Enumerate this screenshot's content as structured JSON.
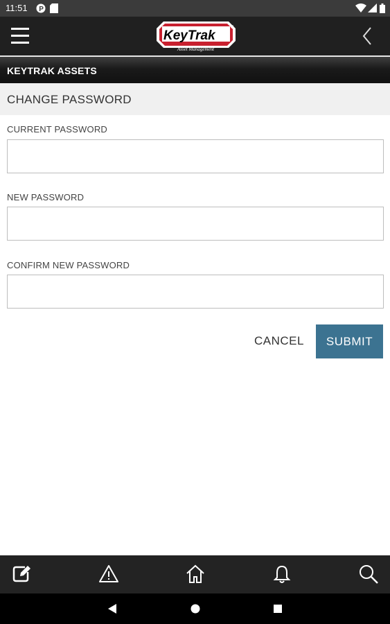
{
  "status_bar": {
    "time": "11:51",
    "left_icons": [
      "p-notification-icon",
      "sd-card-icon"
    ],
    "right_icons": [
      "wifi-icon",
      "cell-signal-icon",
      "battery-icon"
    ]
  },
  "app_bar": {
    "logo_text": "KeyTrak",
    "logo_tagline": "Asset Management",
    "menu_icon": "hamburger-menu-icon",
    "back_icon": "chevron-left-icon"
  },
  "section": {
    "title": "KEYTRAK ASSETS"
  },
  "form": {
    "title": "CHANGE PASSWORD",
    "fields": [
      {
        "label": "CURRENT PASSWORD",
        "value": "",
        "placeholder": ""
      },
      {
        "label": "NEW PASSWORD",
        "value": "",
        "placeholder": ""
      },
      {
        "label": "CONFIRM NEW PASSWORD",
        "value": "",
        "placeholder": ""
      }
    ],
    "cancel_label": "CANCEL",
    "submit_label": "SUBMIT"
  },
  "bottom_nav": {
    "items": [
      "edit-icon",
      "warning-icon",
      "home-icon",
      "bell-icon",
      "search-icon"
    ]
  },
  "system_nav": {
    "items": [
      "back-triangle-icon",
      "home-circle-icon",
      "recents-square-icon"
    ]
  },
  "colors": {
    "app_bar": "#202020",
    "section_bar": "#1a1a1a",
    "header_bg": "#f0f0f0",
    "submit_bg": "#3c7391",
    "logo_red": "#c8202f"
  }
}
